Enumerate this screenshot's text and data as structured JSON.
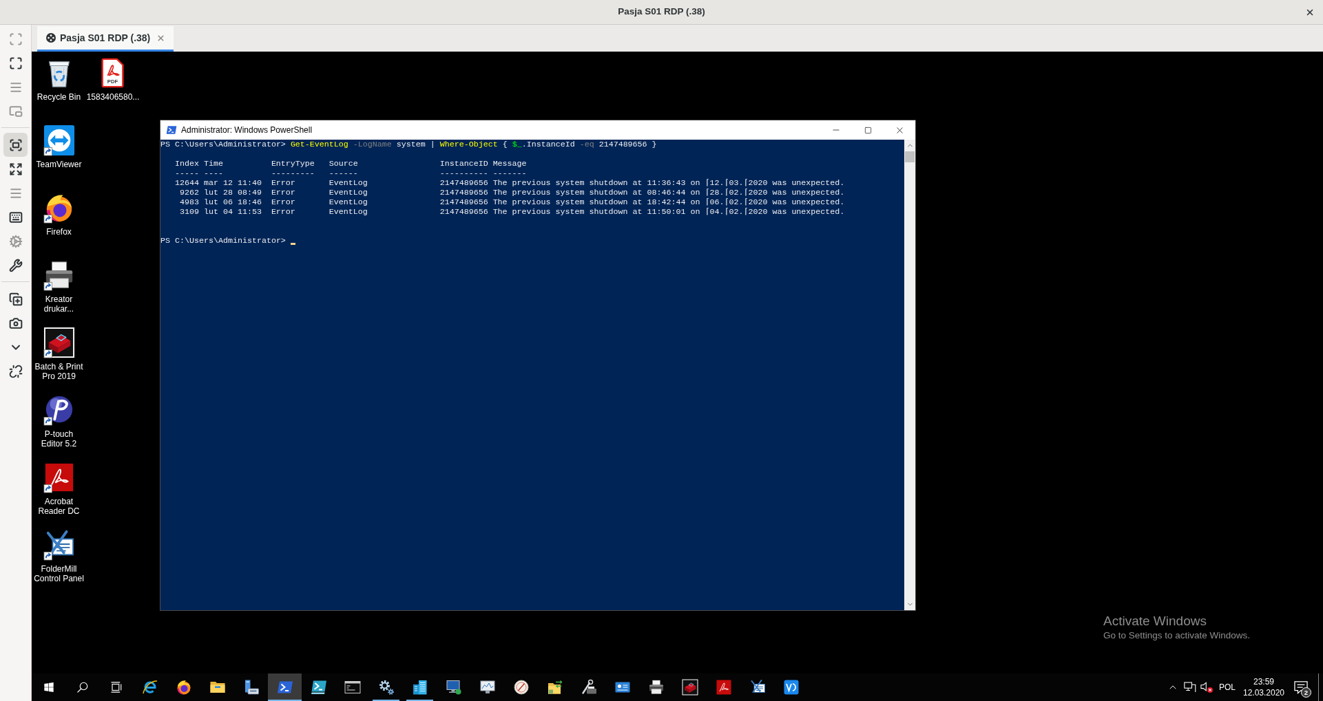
{
  "window": {
    "title": "Pasja S01 RDP (.38)"
  },
  "sidebar": {
    "groups": [
      [
        {
          "kind": "focus",
          "selected": false,
          "disabled": true
        },
        {
          "kind": "fullscreen",
          "selected": false,
          "disabled": false
        },
        {
          "kind": "menu",
          "selected": false,
          "disabled": true
        },
        {
          "kind": "pip",
          "selected": false,
          "disabled": true
        }
      ],
      [
        {
          "kind": "scale",
          "selected": true,
          "disabled": false
        },
        {
          "kind": "resize",
          "selected": false,
          "disabled": false
        },
        {
          "kind": "menu",
          "selected": false,
          "disabled": true
        },
        {
          "kind": "keyboard",
          "selected": false,
          "disabled": false
        },
        {
          "kind": "gears",
          "selected": false,
          "disabled": true
        },
        {
          "kind": "wrench",
          "selected": false,
          "disabled": false
        }
      ],
      [
        {
          "kind": "new_window",
          "selected": false,
          "disabled": false
        },
        {
          "kind": "camera",
          "selected": false,
          "disabled": false
        },
        {
          "kind": "chevron",
          "selected": false,
          "disabled": false
        },
        {
          "kind": "unlink",
          "selected": false,
          "disabled": false
        }
      ]
    ]
  },
  "tabs": [
    {
      "label": "Pasja S01 RDP (.38)",
      "selected": true
    }
  ],
  "desktop": {
    "icons": [
      {
        "label": "Recycle Bin",
        "kind": "bin",
        "shortcut": false
      },
      {
        "label": "1583406580...",
        "kind": "pdf",
        "shortcut": false,
        "caption": "PDF"
      },
      {
        "label": "TeamViewer",
        "kind": "remote",
        "shortcut": true
      },
      {
        "label": "Firefox",
        "kind": "fox",
        "shortcut": true
      },
      {
        "label": "Kreator drukar...",
        "kind": "printer",
        "shortcut": true
      },
      {
        "label": "Batch & Print Pro 2019",
        "kind": "batch_printer",
        "shortcut": true
      },
      {
        "label": "P-touch Editor 5.2",
        "kind": "sphere",
        "shortcut": true
      },
      {
        "label": "Acrobat Reader DC",
        "kind": "reader",
        "shortcut": true
      },
      {
        "label": "FolderMill Control Panel",
        "kind": "tools",
        "shortcut": true
      }
    ]
  },
  "powershell": {
    "title": "Administrator: Windows PowerShell",
    "command_line": [
      {
        "kind": "plain",
        "text": "PS C:\\Users\\Administrator> "
      },
      {
        "kind": "command",
        "text": "Get-EventLog"
      },
      {
        "kind": "parameter",
        "text": " -LogName"
      },
      {
        "kind": "plain",
        "text": " system | "
      },
      {
        "kind": "command",
        "text": "Where-Object"
      },
      {
        "kind": "plain",
        "text": " { "
      },
      {
        "kind": "variable",
        "text": "$_"
      },
      {
        "kind": "plain",
        "text": ".InstanceId "
      },
      {
        "kind": "parameter",
        "text": "-eq"
      },
      {
        "kind": "plain",
        "text": " 2147489656 }"
      }
    ],
    "table": {
      "columns": [
        {
          "label": "Index",
          "rule": "-----"
        },
        {
          "label": "Time",
          "rule": "----"
        },
        {
          "label": "EntryType",
          "rule": "---------"
        },
        {
          "label": "Source",
          "rule": "------"
        },
        {
          "label": "InstanceID",
          "rule": "----------"
        },
        {
          "label": "Message",
          "rule": "-------"
        }
      ],
      "rows": [
        [
          "12644",
          "mar 12 11:40",
          "Error",
          "EventLog",
          "2147489656",
          "The previous system shutdown at 11:36:43 on ⌈12.⌈03.⌈2020 was unexpected."
        ],
        [
          "9262",
          "lut 28 08:49",
          "Error",
          "EventLog",
          "2147489656",
          "The previous system shutdown at 08:46:44 on ⌈28.⌈02.⌈2020 was unexpected."
        ],
        [
          "4983",
          "lut 06 18:46",
          "Error",
          "EventLog",
          "2147489656",
          "The previous system shutdown at 18:42:44 on ⌈06.⌈02.⌈2020 was unexpected."
        ],
        [
          "3109",
          "lut 04 11:53",
          "Error",
          "EventLog",
          "2147489656",
          "The previous system shutdown at 11:50:01 on ⌈04.⌈02.⌈2020 was unexpected."
        ]
      ]
    },
    "prompt": "PS C:\\Users\\Administrator>"
  },
  "activation_notice": {
    "title": "Activate Windows",
    "message": "Go to Settings to activate Windows."
  },
  "taskbar": {
    "items": [
      {
        "kind": "start",
        "running": false,
        "selected": false
      },
      {
        "kind": "search",
        "running": false,
        "selected": false
      },
      {
        "kind": "task_view",
        "running": false,
        "selected": false
      },
      {
        "kind": "ie",
        "running": false,
        "selected": false
      },
      {
        "kind": "fox",
        "running": false,
        "selected": false
      },
      {
        "kind": "explorer",
        "running": false,
        "selected": false
      },
      {
        "kind": "server",
        "running": false,
        "selected": false
      },
      {
        "kind": "shell",
        "running": true,
        "selected": true
      },
      {
        "kind": "shell_ise",
        "running": false,
        "selected": false
      },
      {
        "kind": "console",
        "running": false,
        "selected": false
      },
      {
        "kind": "gears",
        "running": true,
        "selected": false
      },
      {
        "kind": "buildings",
        "running": true,
        "selected": false
      },
      {
        "kind": "monitor",
        "running": false,
        "selected": false
      },
      {
        "kind": "monitor_chart",
        "running": false,
        "selected": false
      },
      {
        "kind": "dial",
        "running": false,
        "selected": false
      },
      {
        "kind": "folder_sync",
        "running": false,
        "selected": false
      },
      {
        "kind": "printer_tools",
        "running": false,
        "selected": false
      },
      {
        "kind": "card",
        "running": false,
        "selected": false
      },
      {
        "kind": "printer",
        "running": false,
        "selected": false
      },
      {
        "kind": "batch_printer",
        "running": false,
        "selected": false
      },
      {
        "kind": "reader",
        "running": false,
        "selected": false
      },
      {
        "kind": "tools",
        "running": false,
        "selected": false
      },
      {
        "kind": "vault",
        "running": false,
        "selected": false
      }
    ],
    "tray": {
      "volume_muted": true,
      "language": "POL",
      "time": "23:59",
      "date": "12.03.2020",
      "notification_count": "2"
    }
  }
}
